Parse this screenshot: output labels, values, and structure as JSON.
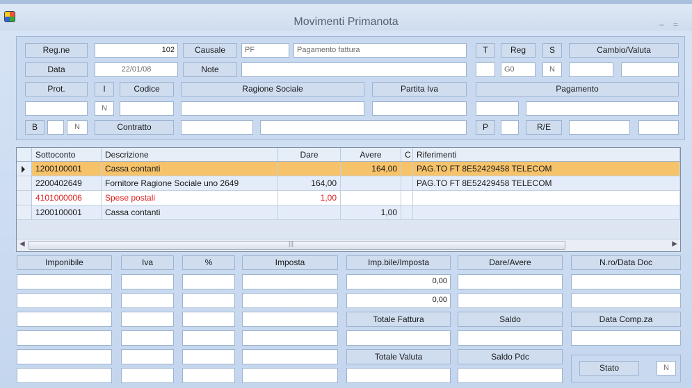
{
  "window": {
    "title": "Movimenti Primanota",
    "minimize": "–",
    "restore": "="
  },
  "header": {
    "regne_label": "Reg.ne",
    "regne_value": "102",
    "causale_label": "Causale",
    "causale_code": "PF",
    "causale_desc": "Pagamento fattura",
    "t_label": "T",
    "reg_label": "Reg",
    "s_label": "S",
    "cambio_label": "Cambio/Valuta",
    "data_label": "Data",
    "data_value": "22/01/08",
    "note_label": "Note",
    "reg_value": "G0",
    "s_value": "N",
    "prot_label": "Prot.",
    "i_label": "I",
    "codice_label": "Codice",
    "ragione_label": "Ragione Sociale",
    "piva_label": "Partita Iva",
    "pagamento_label": "Pagamento",
    "i_value": "N",
    "b_label": "B",
    "b_value": "N",
    "contratto_label": "Contratto",
    "p_label": "P",
    "re_label": "R/E"
  },
  "grid": {
    "columns": [
      "Sottoconto",
      "Descrizione",
      "Dare",
      "Avere",
      "C",
      "Riferimenti"
    ],
    "rows": [
      {
        "sottoconto": "1200100001",
        "descrizione": "Cassa contanti",
        "dare": "",
        "avere": "164,00",
        "c": "",
        "riferimenti": "PAG.TO FT 8E52429458 TELECOM"
      },
      {
        "sottoconto": "2200402649",
        "descrizione": "Fornitore Ragione Sociale uno 2649",
        "dare": "164,00",
        "avere": "",
        "c": "",
        "riferimenti": "PAG.TO FT 8E52429458 TELECOM"
      },
      {
        "sottoconto": "4101000006",
        "descrizione": "Spese postali",
        "dare": "1,00",
        "avere": "",
        "c": "",
        "riferimenti": ""
      },
      {
        "sottoconto": "1200100001",
        "descrizione": "Cassa contanti",
        "dare": "",
        "avere": "1,00",
        "c": "",
        "riferimenti": ""
      }
    ],
    "scroll_grip": "|||"
  },
  "footer": {
    "imponibile_label": "Imponibile",
    "iva_label": "Iva",
    "perc_label": "%",
    "imposta_label": "Imposta",
    "impbile_label": "Imp.bile/Imposta",
    "dareavere_label": "Dare/Avere",
    "nrodata_label": "N.ro/Data Doc",
    "impbile_value1": "0,00",
    "impbile_value2": "0,00",
    "totale_fattura_label": "Totale Fattura",
    "saldo_label": "Saldo",
    "data_comp_label": "Data Comp.za",
    "totale_valuta_label": "Totale Valuta",
    "saldo_pdc_label": "Saldo Pdc",
    "stato_label": "Stato",
    "stato_value": "N"
  },
  "colors": {
    "selected_row": "#f6c36b",
    "alt_row": "#e3ecf8",
    "red_text": "#e02020"
  }
}
